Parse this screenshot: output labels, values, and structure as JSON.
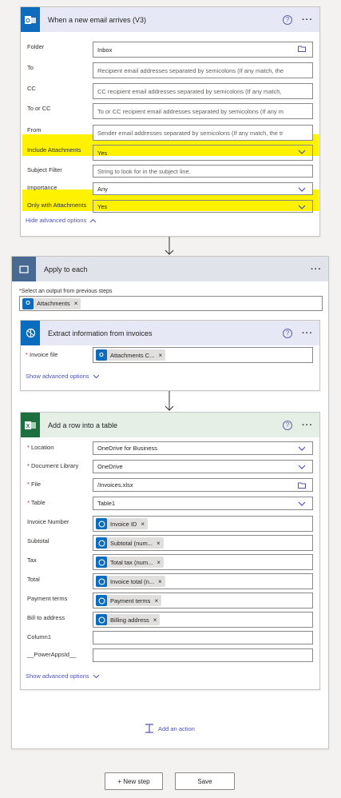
{
  "trigger": {
    "title": "When a new email arrives (V3)",
    "help_icon": "?",
    "more_icon": "···",
    "fields": [
      {
        "label": "Folder",
        "value": "Inbox",
        "placeholder": ""
      },
      {
        "label": "To",
        "value": "",
        "placeholder": "Recipient email addresses separated by semicolons (If any match, the"
      },
      {
        "label": "CC",
        "value": "",
        "placeholder": "CC recipient email addresses separated by semicolons (If any match,"
      },
      {
        "label": "To or CC",
        "value": "",
        "placeholder": "To or CC recipient email addresses separated by semicolons (If any m"
      },
      {
        "label": "From",
        "value": "",
        "placeholder": "Sender email addresses separated by semicolons (If any match, the tr"
      },
      {
        "label": "Include Attachments",
        "value": "Yes",
        "placeholder": ""
      },
      {
        "label": "Subject Filter",
        "value": "",
        "placeholder": "String to look for in the subject line."
      },
      {
        "label": "Importance",
        "value": "Any",
        "placeholder": ""
      },
      {
        "label": "Only with Attachments",
        "value": "Yes",
        "placeholder": ""
      }
    ],
    "hide_advanced": "Hide advanced options",
    "colors": {
      "accent": "#4f6bed",
      "highlight": "#fff200"
    }
  },
  "apply_each": {
    "title": "Apply to each",
    "more_icon": "···",
    "select_label": "Select an output from previous steps",
    "token": "Attachments"
  },
  "extract": {
    "title": "Extract information from invoices",
    "help_icon": "?",
    "more_icon": "···",
    "invoice_label": "Invoice file",
    "invoice_token": "Attachments C...",
    "show_advanced": "Show advanced options"
  },
  "add_row": {
    "title": "Add a row into a table",
    "help_icon": "?",
    "more_icon": "···",
    "fields": [
      {
        "label": "Location",
        "required": true,
        "value": "OneDrive for Business",
        "kind": "dropdown"
      },
      {
        "label": "Document Library",
        "required": true,
        "value": "OneDrive",
        "kind": "dropdown"
      },
      {
        "label": "File",
        "required": true,
        "value": "/Invoices.xlsx",
        "kind": "file"
      },
      {
        "label": "Table",
        "required": true,
        "value": "Table1",
        "kind": "dropdown"
      },
      {
        "label": "Invoice Number",
        "required": false,
        "value": "Invoice ID",
        "kind": "token"
      },
      {
        "label": "Subtotal",
        "required": false,
        "value": "Subtotal (num...",
        "kind": "token"
      },
      {
        "label": "Tax",
        "required": false,
        "value": "Total tax (num...",
        "kind": "token"
      },
      {
        "label": "Total",
        "required": false,
        "value": "Invoice total (n...",
        "kind": "token"
      },
      {
        "label": "Payment terms",
        "required": false,
        "value": "Payment terms",
        "kind": "token"
      },
      {
        "label": "Bill to address",
        "required": false,
        "value": "Billing address",
        "kind": "token"
      },
      {
        "label": "Column1",
        "required": false,
        "value": "",
        "kind": "text"
      },
      {
        "label": "__PowerAppsId__",
        "required": false,
        "value": "",
        "kind": "text"
      }
    ],
    "show_advanced": "Show advanced options",
    "colors": {
      "header": "#e5efe6",
      "excel": "#1e6f3f"
    }
  },
  "add_action": "Add an action",
  "footer": {
    "new_step": "+ New step",
    "save": "Save"
  }
}
